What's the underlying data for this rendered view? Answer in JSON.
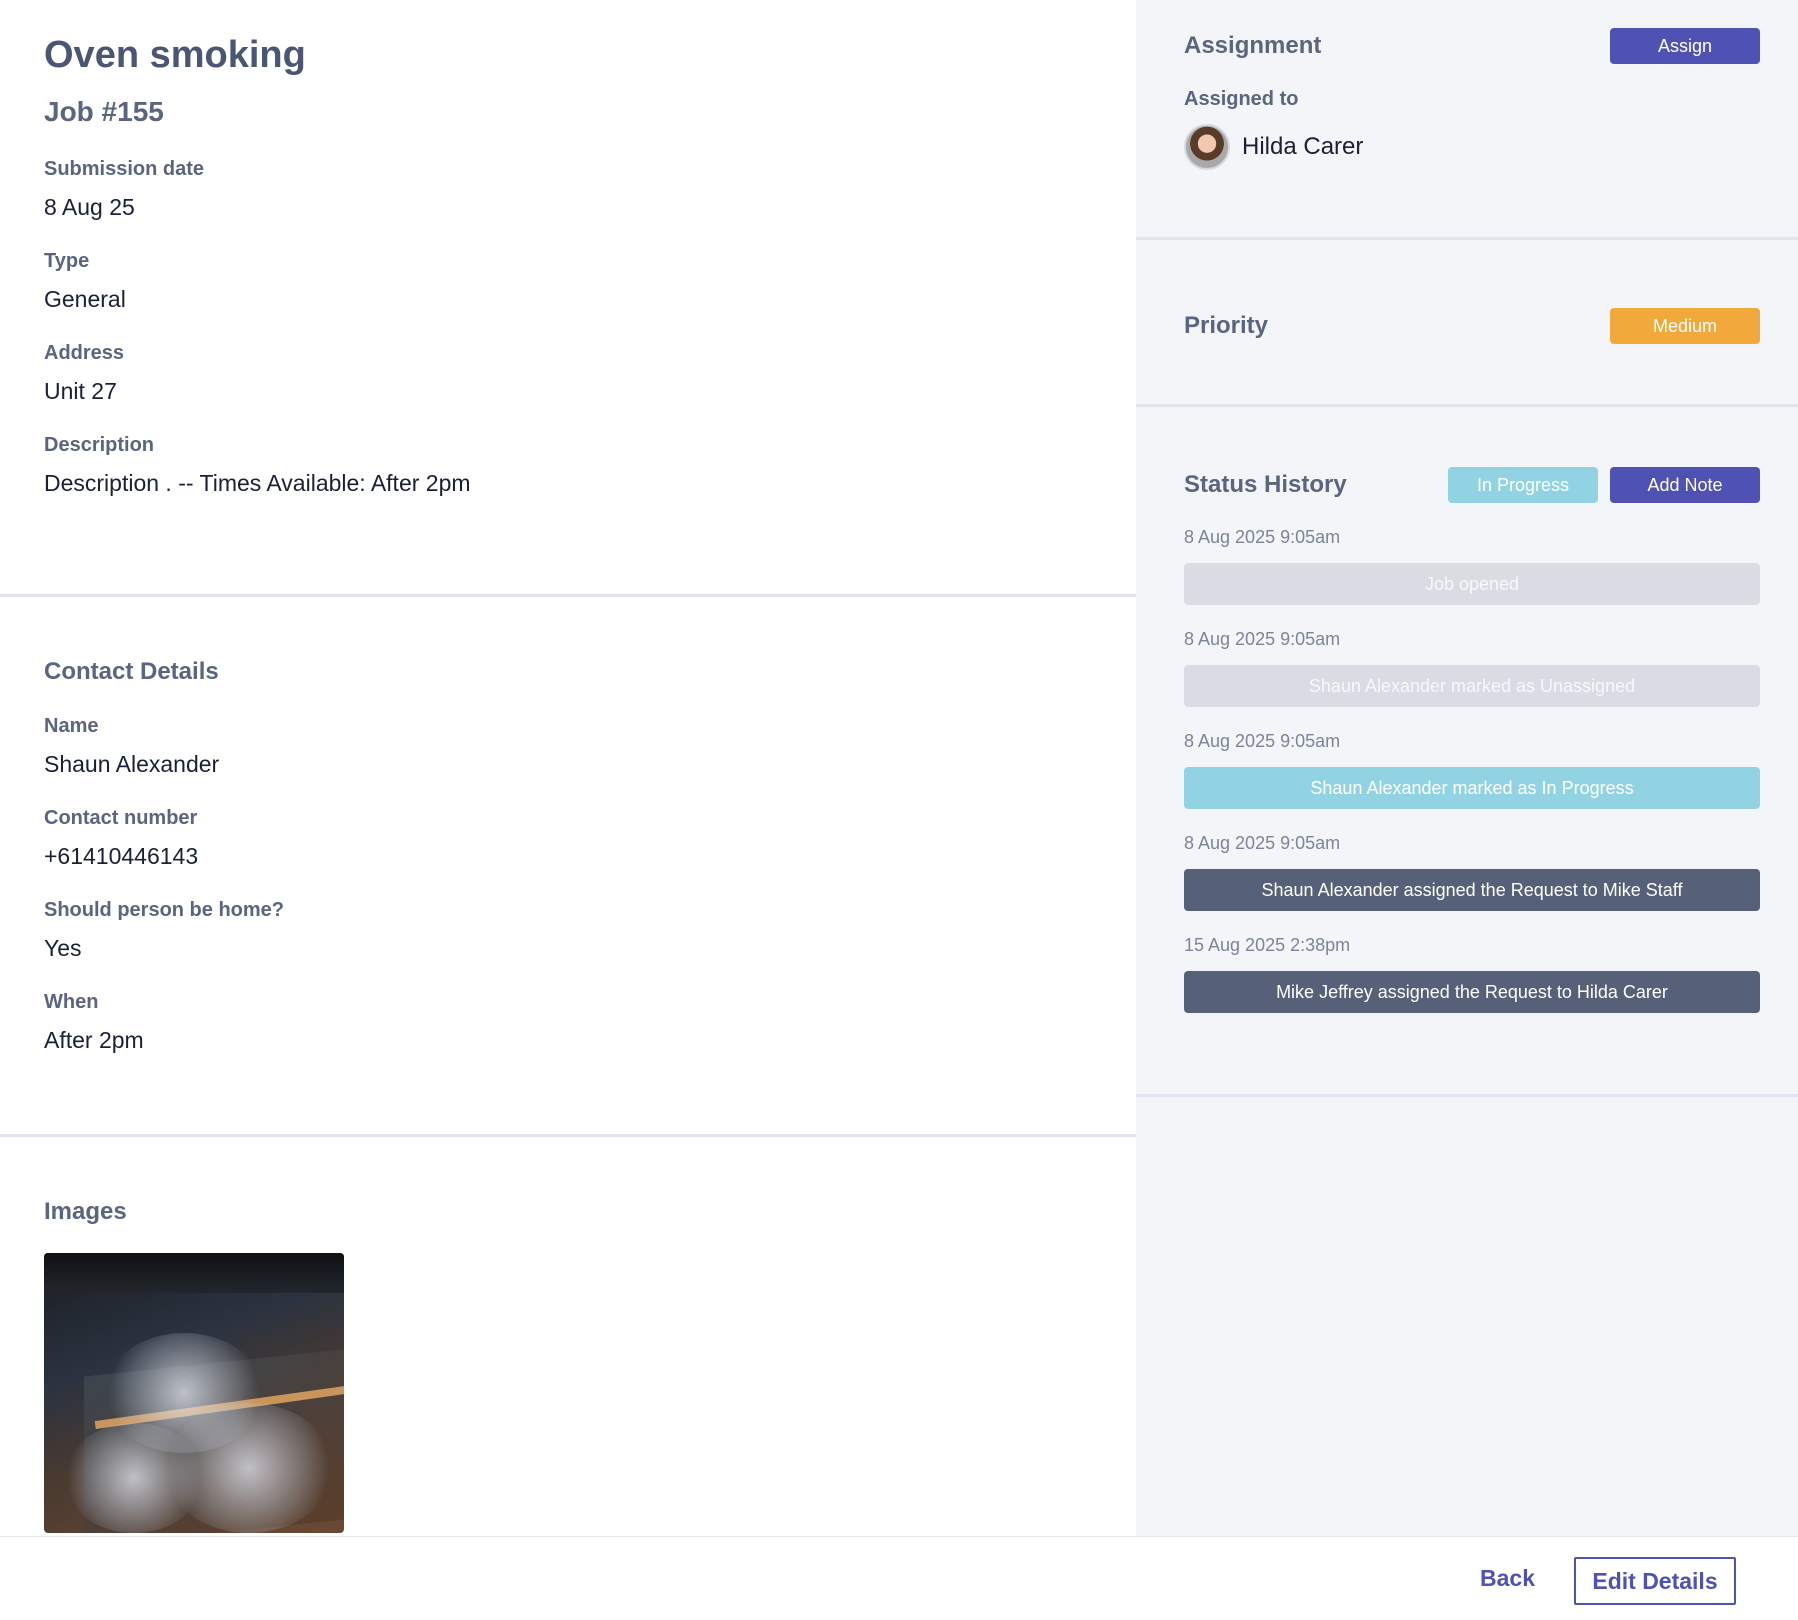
{
  "job": {
    "title": "Oven smoking",
    "number": "Job #155",
    "fields": [
      {
        "label": "Submission date",
        "value": "8 Aug 25"
      },
      {
        "label": "Type",
        "value": "General"
      },
      {
        "label": "Address",
        "value": "Unit 27"
      },
      {
        "label": "Description",
        "value": "Description . -- Times Available: After 2pm"
      }
    ]
  },
  "contact": {
    "title": "Contact Details",
    "fields": [
      {
        "label": "Name",
        "value": "Shaun Alexander"
      },
      {
        "label": "Contact number",
        "value": "+61410446143"
      },
      {
        "label": "Should person be home?",
        "value": "Yes"
      },
      {
        "label": "When",
        "value": "After 2pm"
      }
    ]
  },
  "images": {
    "title": "Images"
  },
  "assignment": {
    "title": "Assignment",
    "assign_label": "Assign",
    "assigned_to_label": "Assigned to",
    "assignee_name": "Hilda Carer"
  },
  "priority": {
    "title": "Priority",
    "value": "Medium",
    "color": "#f0a93a"
  },
  "status_history": {
    "title": "Status History",
    "current_status": "In Progress",
    "add_note_label": "Add Note",
    "entries": [
      {
        "date": "8 Aug 2025 9:05am",
        "text": "Job opened",
        "style": "gray"
      },
      {
        "date": "8 Aug 2025 9:05am",
        "text": "Shaun Alexander marked as Unassigned",
        "style": "gray"
      },
      {
        "date": "8 Aug 2025 9:05am",
        "text": "Shaun Alexander marked as In Progress",
        "style": "cyan"
      },
      {
        "date": "8 Aug 2025 9:05am",
        "text": "Shaun Alexander assigned the Request to Mike Staff",
        "style": "dark"
      },
      {
        "date": "15 Aug 2025 2:38pm",
        "text": "Mike Jeffrey assigned the Request to Hilda Carer",
        "style": "dark"
      }
    ]
  },
  "footer": {
    "back_label": "Back",
    "edit_label": "Edit Details"
  },
  "colors": {
    "primary": "#4f52b3",
    "medium": "#f0a93a",
    "in_progress": "#92d3e3",
    "history_dark": "#566079"
  }
}
